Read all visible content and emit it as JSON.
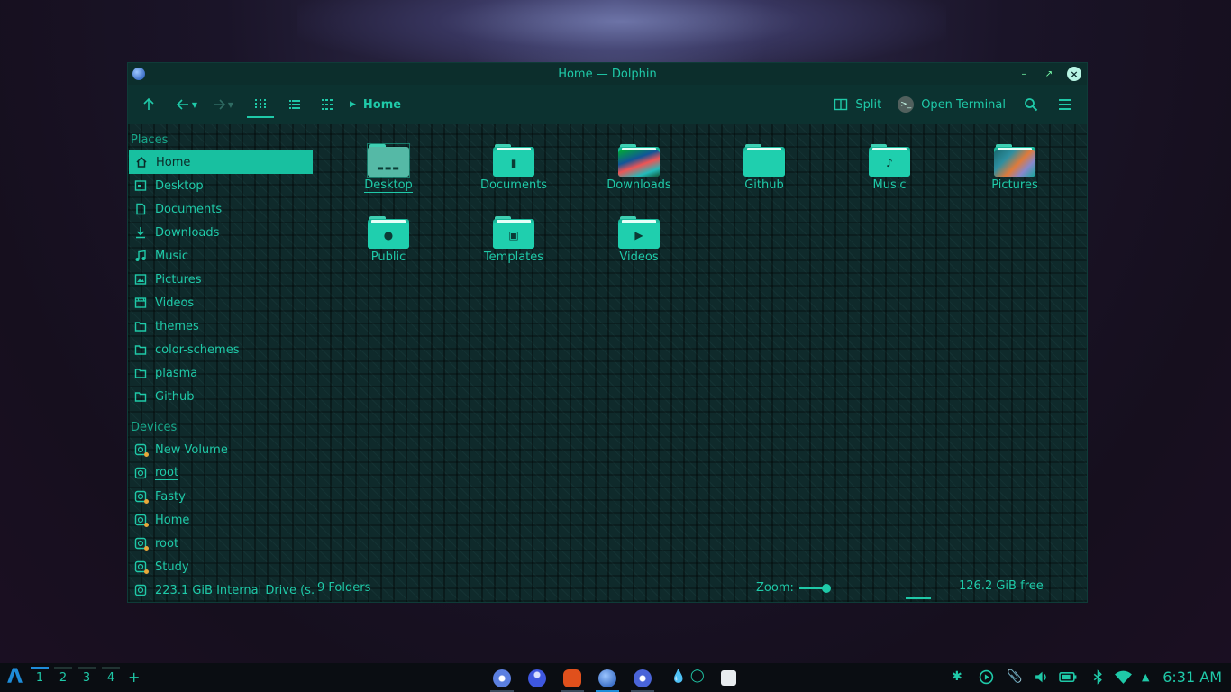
{
  "window": {
    "title": "Home — Dolphin"
  },
  "toolbar": {
    "breadcrumb": "Home",
    "split_label": "Split",
    "terminal_label": "Open Terminal"
  },
  "sidebar": {
    "places_header": "Places",
    "places": [
      "Home",
      "Desktop",
      "Documents",
      "Downloads",
      "Music",
      "Pictures",
      "Videos",
      "themes",
      "color-schemes",
      "plasma",
      "Github"
    ],
    "devices_header": "Devices",
    "devices": [
      "New Volume",
      "root",
      "Fasty",
      "Home",
      "root",
      "Study",
      "223.1 GiB Internal Drive (s..."
    ]
  },
  "view": {
    "items": [
      "Desktop",
      "Documents",
      "Downloads",
      "Github",
      "Music",
      "Pictures",
      "Public",
      "Templates",
      "Videos"
    ]
  },
  "status": {
    "count": "9 Folders",
    "zoom_label": "Zoom:",
    "free": "126.2 GiB free"
  },
  "taskbar": {
    "desktops": [
      "1",
      "2",
      "3",
      "4"
    ],
    "add": "+",
    "clock": "6:31 AM"
  },
  "colors": {
    "accent": "#1fc9a8",
    "selection": "#18c0a0",
    "taskbar_accent": "#1e8cd8"
  }
}
